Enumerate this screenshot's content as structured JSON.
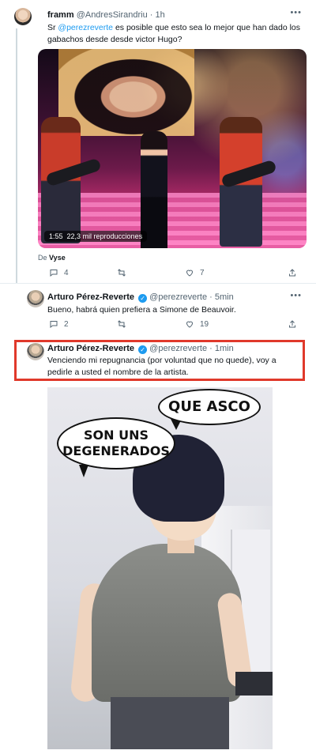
{
  "tweet1": {
    "display_name": "framm",
    "handle": "@AndresSirandriu",
    "time": "· 1h",
    "text_before": "Sr ",
    "mention": "@perezreverte",
    "text_after": " es posible que esto sea lo mejor que han dado los gabachos desde desde victor Hugo?",
    "video_views": "1:55  22,3 mil reproducciones",
    "credit_prefix": "De ",
    "credit_name": "Vyse",
    "replies": "4",
    "retweets": "",
    "likes": "7"
  },
  "tweet2": {
    "display_name": "Arturo Pérez-Reverte",
    "handle": "@perezreverte",
    "time": "· 5min",
    "text": "Bueno, habrá quien prefiera a Simone de Beauvoir.",
    "replies": "2",
    "retweets": "",
    "likes": "19"
  },
  "tweet3": {
    "display_name": "Arturo Pérez-Reverte",
    "handle": "@perezreverte",
    "time": "· 1min",
    "text": "Venciendo mi repugnancia (por voluntad que no quede), voy a pedirle a usted el nombre de la artista."
  },
  "meme": {
    "bubble_top": "QUE ASCO",
    "bubble_left": "SON UNS\nDEGENERADOS"
  },
  "icons": {
    "more": "more-horizontal-icon",
    "verified": "verified-badge-icon",
    "reply": "reply-icon",
    "retweet": "retweet-icon",
    "like": "heart-icon",
    "share": "share-icon"
  },
  "colors": {
    "link": "#1d9bf0",
    "highlight_border": "#e0392b",
    "secondary_text": "#536471"
  }
}
